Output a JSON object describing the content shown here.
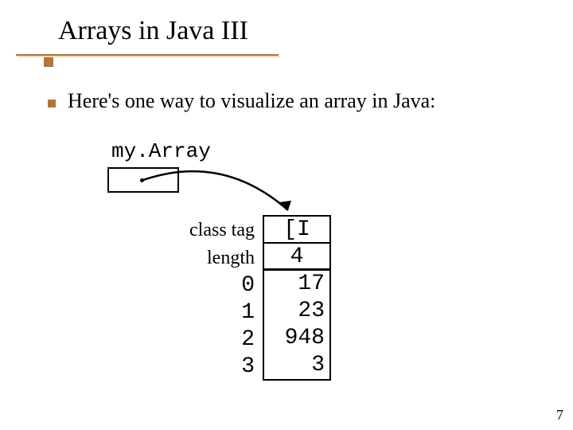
{
  "title": "Arrays in Java III",
  "bullet_text": "Here's one way to visualize an array in Java:",
  "var_name": "my.Array",
  "row_labels": {
    "class_tag": "class tag",
    "length": "length"
  },
  "header": {
    "class_tag_value": "[I",
    "length_value": "4"
  },
  "indices": [
    "0",
    "1",
    "2",
    "3"
  ],
  "values": [
    "17",
    "23",
    "948",
    "3"
  ],
  "page_number": "7"
}
